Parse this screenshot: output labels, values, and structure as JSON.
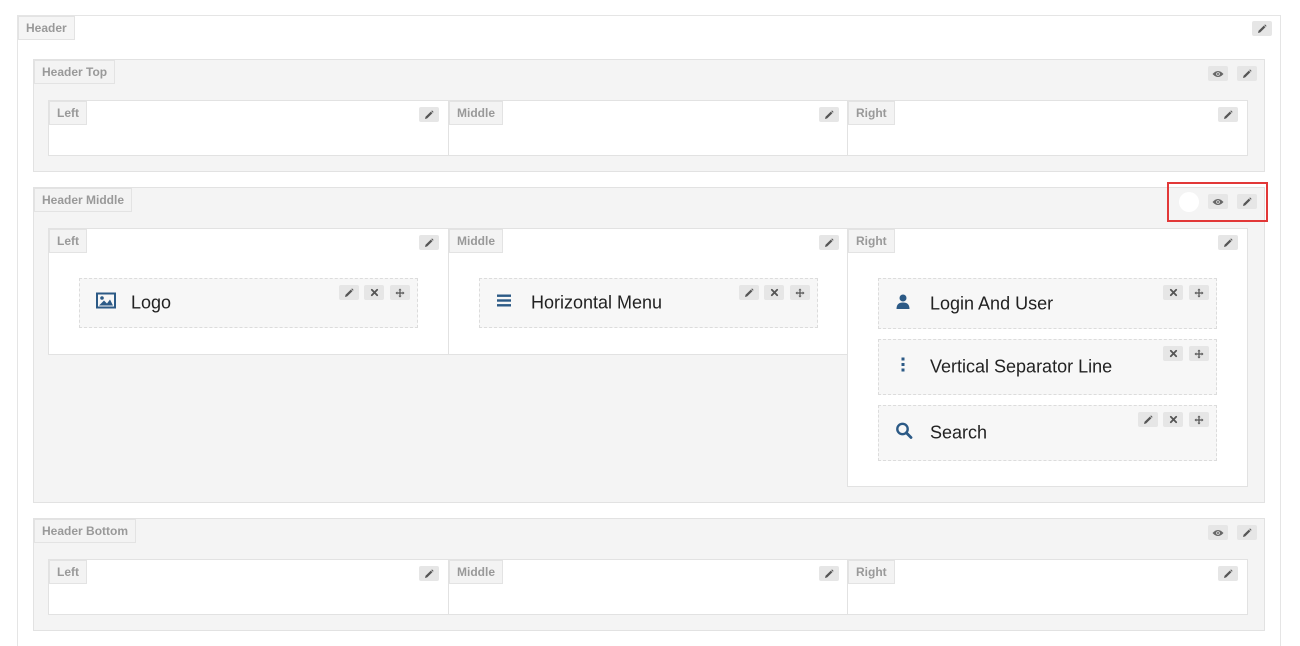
{
  "header": {
    "label": "Header"
  },
  "sections": {
    "top": {
      "label": "Header Top",
      "columns": {
        "left": "Left",
        "middle": "Middle",
        "right": "Right"
      }
    },
    "middle": {
      "label": "Header Middle",
      "columns": {
        "left": "Left",
        "middle": "Middle",
        "right": "Right"
      },
      "widgets": {
        "logo": {
          "label": "Logo",
          "icon": "image-icon"
        },
        "horizontal_menu": {
          "label": "Horizontal Menu",
          "icon": "bars-icon"
        },
        "login_user": {
          "label": "Login And User",
          "icon": "user-icon"
        },
        "vertical_separator": {
          "label": "Vertical Separator Line",
          "icon": "ellipsis-vertical-icon"
        },
        "search": {
          "label": "Search",
          "icon": "search-icon"
        }
      }
    },
    "bottom": {
      "label": "Header Bottom",
      "columns": {
        "left": "Left",
        "middle": "Middle",
        "right": "Right"
      }
    }
  },
  "colors": {
    "widget_icon": "#2c5a86",
    "highlight": "#e23838",
    "section_bg": "#f4f4f4",
    "tag_text": "#999999"
  }
}
